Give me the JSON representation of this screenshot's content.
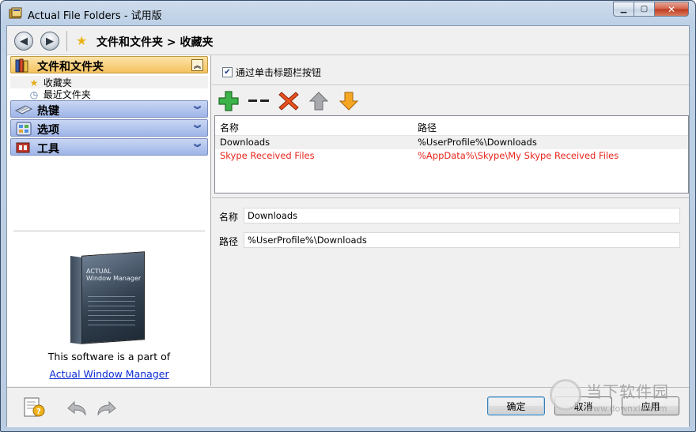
{
  "window": {
    "title": "Actual File Folders - 试用版",
    "minimize_icon": "minimize-icon",
    "maximize_icon": "maximize-icon",
    "close_icon": "close-icon"
  },
  "nav": {
    "back_icon": "back-arrow-icon",
    "forward_icon": "forward-arrow-icon",
    "breadcrumb": "文件和文件夹 > 收藏夹"
  },
  "sidebar": {
    "groups": [
      {
        "label": "文件和文件夹",
        "icon": "folder-books-icon",
        "expanded": true
      },
      {
        "label": "热键",
        "icon": "keyboard-icon",
        "expanded": false
      },
      {
        "label": "选项",
        "icon": "options-icon",
        "expanded": false
      },
      {
        "label": "工具",
        "icon": "tools-icon",
        "expanded": false
      }
    ],
    "items": [
      {
        "label": "收藏夹",
        "icon": "star-icon"
      },
      {
        "label": "最近文件夹",
        "icon": "recent-icon"
      }
    ],
    "promo_text": "This software is a part of",
    "promo_link": "Actual Window Manager",
    "product_box_title": "ACTUAL\nWindow Manager"
  },
  "main": {
    "checkbox_label": "通过单击标题栏按钮",
    "checkbox_checked": true,
    "toolbar": {
      "add_icon": "add-icon",
      "separator_icon": "separator-icon",
      "delete_icon": "delete-icon",
      "up_icon": "move-up-icon",
      "down_icon": "move-down-icon"
    },
    "table": {
      "headers": [
        "名称",
        "路径"
      ],
      "rows": [
        {
          "name": "Downloads",
          "path": "%UserProfile%\\Downloads",
          "color": "#000000"
        },
        {
          "name": "Skype Received Files",
          "path": "%AppData%\\Skype\\My Skype Received Files",
          "color": "#e8261e"
        }
      ]
    },
    "name_label": "名称",
    "name_value": "Downloads",
    "path_label": "路径",
    "path_value": "%UserProfile%\\Downloads"
  },
  "footer": {
    "help_icon": "help-icon",
    "undo_icon": "undo-icon",
    "redo_icon": "redo-icon",
    "ok_label": "确定",
    "cancel_label": "取消",
    "apply_label": "应用"
  },
  "watermark": {
    "text": "当下软件园",
    "url": "www.downxia.com"
  }
}
